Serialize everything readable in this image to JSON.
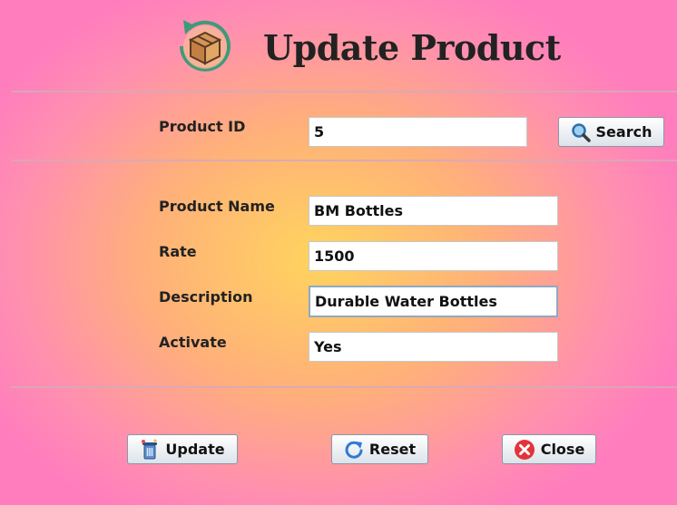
{
  "window": {
    "title": "Update Product"
  },
  "icons": {
    "logo": "box-refresh-icon",
    "search": "magnifier-icon",
    "update": "trash-can-icon",
    "reset": "refresh-icon",
    "close": "close-circle-icon"
  },
  "search": {
    "label": "Product ID",
    "value": "5",
    "button": "Search"
  },
  "form": {
    "name_label": "Product Name",
    "name_value": "BM Bottles",
    "rate_label": "Rate",
    "rate_value": "1500",
    "desc_label": "Description",
    "desc_value": "Durable Water Bottles",
    "active_label": "Activate",
    "active_value": "Yes"
  },
  "actions": {
    "update": "Update",
    "reset": "Reset",
    "close": "Close"
  }
}
